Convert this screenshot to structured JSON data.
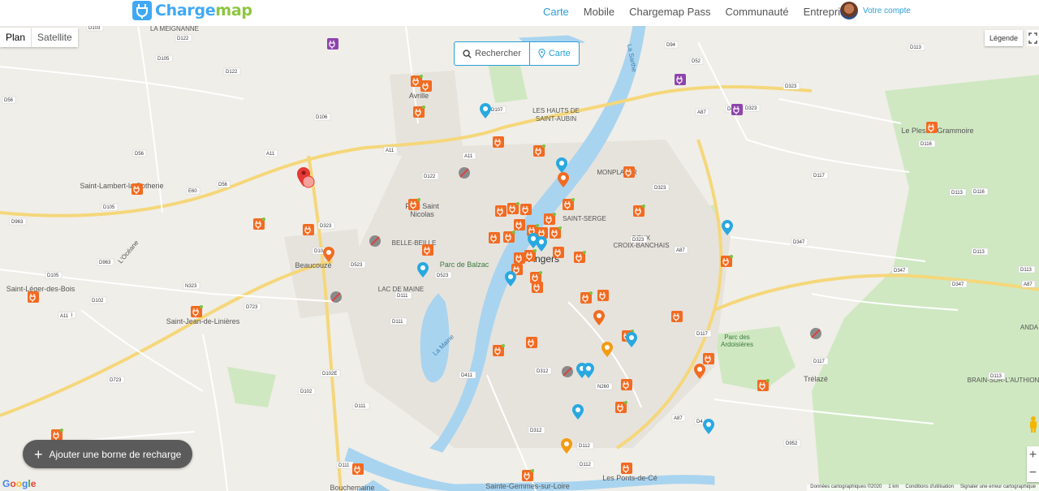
{
  "header": {
    "logo_text_a": "Charge",
    "logo_text_b": "map",
    "nav": [
      "Carte",
      "Mobile",
      "Chargemap Pass",
      "Communauté",
      "Entreprises"
    ],
    "account_label": "Votre compte"
  },
  "map_controls": {
    "plan": "Plan",
    "satellite": "Satellite",
    "search": "Rechercher",
    "map_mode": "Carte",
    "legend": "Légende",
    "add_station": "Ajouter une borne de recharge",
    "zoom_in": "+",
    "zoom_out": "−"
  },
  "attribution": {
    "data": "Données cartographiques ©2020",
    "scale": "1 km",
    "terms": "Conditions d'utilisation",
    "report": "Signaler une erreur cartographique"
  },
  "places": [
    "LA MEIGNANNE",
    "Avrille",
    "LES HAUTS DE",
    "SAINT-AUBIN",
    "MONPLAISIR",
    "Saint-Lambert-la-Potherie",
    "Parc Saint",
    "Nicolas",
    "SAINT-SERGE",
    "DEUX",
    "CROIX-BANCHAIS",
    "BELLE-BEILLE",
    "Beaucouzé",
    "Parc de Balzac",
    "Angers",
    "LAC DE MAINE",
    "Saint-Léger-des-Bois",
    "Saint-Jean-de-Linières",
    "Parc des",
    "Ardoisières",
    "Trélazé",
    "BRAIN-SUR-L'AUTHION",
    "ANDA",
    "Le Plessis-Grammoire",
    "Sainte-Gemmes-sur-Loire",
    "Les Ponts-de-Cé",
    "Bouchemaine",
    "La Maine",
    "La Sarthe",
    "L'Océane"
  ],
  "roads": [
    "D103",
    "D122",
    "D105",
    "D122",
    "D56",
    "D56",
    "D106",
    "A11",
    "A11",
    "A11",
    "E60",
    "D56",
    "D105",
    "D963",
    "D963",
    "D105",
    "D102",
    "N323",
    "N323",
    "D723",
    "A11",
    "D723",
    "D107",
    "D122",
    "D323",
    "D323",
    "D10",
    "D523",
    "D523",
    "D111",
    "D111",
    "D102E",
    "D102",
    "D111",
    "D111",
    "D411",
    "D312",
    "D312",
    "D112",
    "D112",
    "N260",
    "D323",
    "D117",
    "D117",
    "D323",
    "D94",
    "D52",
    "D323",
    "D116",
    "D116",
    "D113",
    "D113",
    "D113",
    "D347",
    "D347",
    "D347",
    "A87",
    "A87",
    "A87",
    "A87",
    "D4",
    "D4",
    "D952",
    "D117",
    "D113",
    "D113"
  ],
  "colors": {
    "brand_blue": "#3fa9f5",
    "brand_green": "#8cc63f",
    "station_orange": "#f26b22",
    "station_blue": "#29a8e0",
    "station_purple": "#8e44ad",
    "station_grey": "#8a8a8a",
    "station_amber": "#f39c12",
    "selected_red": "#e53935"
  },
  "icons": [
    "search-icon",
    "location-pin-icon",
    "plus-icon",
    "fullscreen-icon",
    "pegman-icon",
    "plug-icon"
  ]
}
